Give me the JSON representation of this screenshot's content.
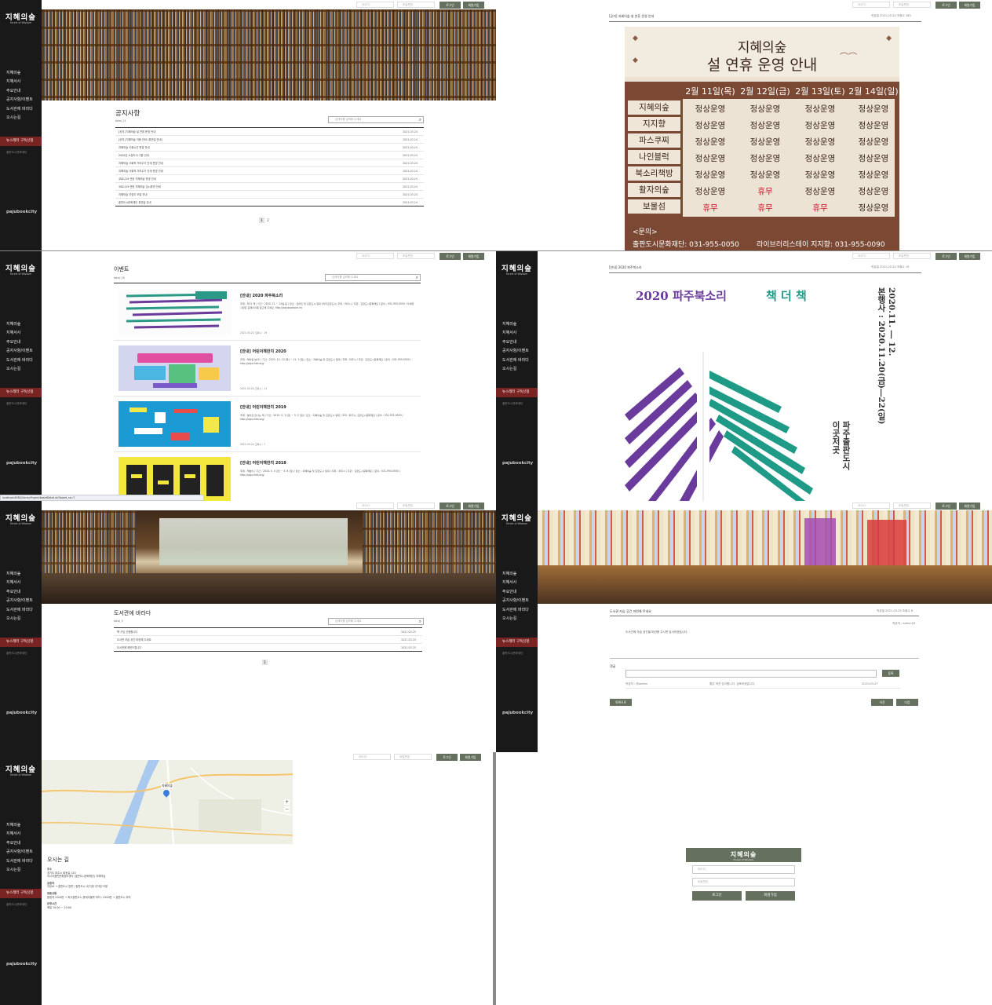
{
  "sidebar": {
    "logo": "지혜의숲",
    "logo_sub": "Forest of Wisdom",
    "menu": [
      "지혜의숲",
      "지혜서사",
      "주요안내",
      "공지사항/이벤트",
      "도서관에 바라다",
      "오시는길"
    ],
    "cta": "뉴스레터 구독신청",
    "cta_sub": "출판도시문화재단",
    "brand": "pajubookcity"
  },
  "topbar": {
    "id_placeholder": "아이디",
    "pw_placeholder": "비밀번호",
    "login": "로그인",
    "signup": "회원가입"
  },
  "notice": {
    "title": "공지사항",
    "total": "total_11",
    "search_placeholder": "검색어를 입력해 주세요",
    "rows": [
      {
        "t": "[공지] 지혜의숲 설 연휴 운영 안내",
        "d": "2021.03.24"
      },
      {
        "t": "[공지] 지혜의숲 이용 안내 (휴관일 안내)",
        "d": "2021.03.24"
      },
      {
        "t": "지혜의숲 이용시간 변경 안내",
        "d": "2021.03.24"
      },
      {
        "t": "2020년 소장도서 기증 안내",
        "d": "2021.03.24"
      },
      {
        "t": "지혜의숲 사회적 거리두기 단계 운영 안내",
        "d": "2021.03.24"
      },
      {
        "t": "지혜의숲 사회적 거리두기 단계 운영 안내",
        "d": "2021.03.24"
      },
      {
        "t": "코로나19 관련 지혜의숲 운영 안내",
        "d": "2021.03.24"
      },
      {
        "t": "코로나19 관련 지혜의숲 임시휴관 안내",
        "d": "2021.03.24"
      },
      {
        "t": "지혜의숲 지킴이 모집 안내",
        "d": "2021.03.24"
      },
      {
        "t": "출판도시문화재단 휴관일 안내",
        "d": "2021.03.24"
      }
    ],
    "pages": [
      "1",
      "2"
    ]
  },
  "notice_detail": {
    "header": "[공지] 지혜의숲 설 연휴 운영 안내",
    "meta": "작성일 2021.03.24   조회수 183"
  },
  "poster": {
    "title1": "지혜의숲",
    "title2": "설 연휴 운영 안내",
    "days": [
      "2월 11일(목)",
      "2월 12일(금)",
      "2월 13일(토)",
      "2월 14일(일)"
    ],
    "rows": [
      {
        "name": "지혜의숲",
        "v": [
          "정상운영",
          "정상운영",
          "정상운영",
          "정상운영"
        ]
      },
      {
        "name": "지지향",
        "v": [
          "정상운영",
          "정상운영",
          "정상운영",
          "정상운영"
        ]
      },
      {
        "name": "파스쿠찌",
        "v": [
          "정상운영",
          "정상운영",
          "정상운영",
          "정상운영"
        ]
      },
      {
        "name": "나인블럭",
        "v": [
          "정상운영",
          "정상운영",
          "정상운영",
          "정상운영"
        ]
      },
      {
        "name": "북소리책방",
        "v": [
          "정상운영",
          "정상운영",
          "정상운영",
          "정상운영"
        ]
      },
      {
        "name": "활자의숲",
        "v": [
          "정상운영",
          "휴무",
          "정상운영",
          "정상운영"
        ]
      },
      {
        "name": "보물섬",
        "v": [
          "휴무",
          "휴무",
          "휴무",
          "정상운영"
        ]
      }
    ],
    "contact_label": "<문의>",
    "contact_1": "출판도시문화재단: 031-955-0050",
    "contact_2": "라이브러리스테이 지지향: 031-955-0090"
  },
  "events": {
    "title": "이벤트",
    "total": "total_10",
    "search_placeholder": "검색어를 입력해 주세요",
    "items": [
      {
        "title": "[안내] 2020 파주북소리",
        "body": "주제 : 책 더 책 / 기간 : 2020. 11 ~ 12월 중 / 장소 : 온라인 및 출판도시 일대 (파주출판도시) 주최 : 파주시 / 주관 : 출판도시문화재단 / 문의 : 031-955-0050 / 자세한 사항은 홈페이지를 참고해 주세요. http://pajubooksori.kr/",
        "meta": "2021.03.24     조회수 : 19"
      },
      {
        "title": "[안내] 어린이책잔치 2020",
        "body": "주제 : 책이랑 놀자! / 기간 : 2020. 10. 13 (화) ~ 11. 1 (일) / 장소 : 지혜의숲 및 출판도시 일대 / 주최 : 파주시 / 주관 : 출판도시문화재단 / 문의 : 031-955-0050 / http://pajuchild.org/",
        "meta": "2021.03.24     조회수 : 11"
      },
      {
        "title": "[안내] 어린이책잔치 2019",
        "body": "주제 : 놀이로 만나는 책 / 기간 : 2019. 5. 3 (금) ~ 5. 5 (일) / 장소 : 지혜의숲 및 출판도시 일대 / 주최 : 파주시, 출판도시문화재단 / 문의 : 031-955-0050 / http://pajuchild.org/",
        "meta": "2021.03.24     조회수 : 7"
      },
      {
        "title": "[안내] 어린이책잔치 2018",
        "body": "주제 : 책놀이 / 기간 : 2018. 5. 4 (금) ~ 5. 6 (일) / 장소 : 지혜의숲 및 출판도시 일대 / 주최 : 파주시 / 주관 : 출판도시문화재단 / 문의 : 031-955-0050 / http://pajuchild.org/",
        "meta": ""
      }
    ]
  },
  "event_detail": {
    "header": "[안내] 2020 파주북소리",
    "meta": "작성일 2021.03.24   조회수 19",
    "year": "2020 파주북소리",
    "theme": "책 더 책",
    "side1": "2020.11. ― 12.",
    "side2": "본행사 : 2020.11.20(금)―22(일)",
    "side3": "파주출판도시",
    "side4": "이곳저곳"
  },
  "status_url": "localhost:8080/LibraryProject/boardDetail.do?board_no=7",
  "hope": {
    "title": "도서관에 바라다",
    "total": "total_3",
    "search_placeholder": "검색어를 입력해 주세요",
    "rows": [
      {
        "t": "책 구입 신청합니다",
        "d": "2021.03.25"
      },
      {
        "t": "도서관 자습 공간 마련해 주세요",
        "d": "2021.03.25"
      },
      {
        "t": "도서관에 제안드립니다",
        "d": "2021.03.25"
      }
    ],
    "pages": [
      "1"
    ]
  },
  "hope_detail": {
    "header": "도서관 자습 공간 마련해 주세요",
    "meta": "작성일 2021.03.25   조회수 6",
    "writer": "작성자 : admin03",
    "body": "도서관에 자습 공간을 마련해 주시면 감사하겠습니다.",
    "comment_label": "댓글",
    "comment_btn": "등록",
    "comment_user": "작성자 : @admin",
    "comment_text": "좋은 의견 감사합니다. 검토하겠습니다.",
    "comment_date": "2021.03.27",
    "list_btn": "목록으로",
    "prev_btn": "이전",
    "next_btn": "다음"
  },
  "directions": {
    "title": "오시는 길",
    "map_label": "지혜의숲",
    "zoom_in": "+",
    "zoom_out": "−",
    "address_label": "주소",
    "address": "경기도 파주시 회동길 145",
    "address_sub": "아시아출판문화정보센터 (출판도시문화재단) 지혜의숲",
    "transit_label": "승용차",
    "transit": "자유로 → 출판도시 방면 / 출판도시 내 지정 주차장 이용",
    "bus_label": "대중교통",
    "bus": "합정역 2200번 → 파주출판도시 롯데아울렛 하차 / 2500번 → 출판도시 하차",
    "hours_label": "운영시간",
    "hours": "매일 10:00 ~ 20:00"
  },
  "login": {
    "logo": "지혜의숲",
    "logo_sub": "Forest of Wisdom",
    "id_placeholder": "아이디",
    "pw_placeholder": "비밀번호",
    "login": "로그인",
    "signup": "회원가입"
  },
  "colors": {
    "sidebar": "#191919",
    "accent": "#66705f",
    "cta": "#7a2323",
    "poster_brown": "#7a4833",
    "purple": "#6a3a9c",
    "teal": "#1f9a86",
    "red": "#c8182a"
  }
}
